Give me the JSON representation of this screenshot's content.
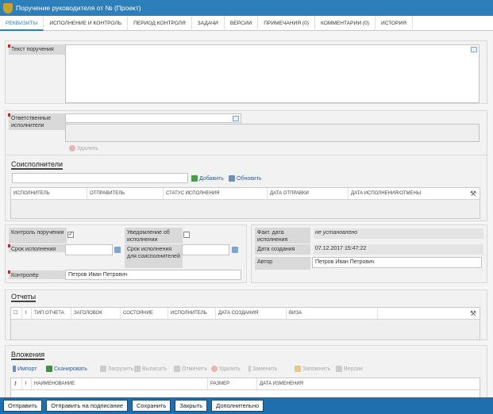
{
  "window": {
    "title": "Поручение руководителя от № (Проект)"
  },
  "tabs": [
    "РЕКВИЗИТЫ",
    "ИСПОЛНЕНИЕ И КОНТРОЛЬ",
    "ПЕРИОД КОНТРОЛЯ",
    "ЗАДАЧИ",
    "ВЕРСИИ",
    "ПРИМЕЧАНИЯ (0)",
    "КОММЕНТАРИИ (0)",
    "ИСТОРИЯ"
  ],
  "assignment": {
    "text_label": "Текст поручения"
  },
  "responsible": {
    "label": "Ответственные исполнители",
    "delete_label": "Удалить"
  },
  "coexecutors": {
    "title": "Соисполнители",
    "add_label": "Добавить",
    "refresh_label": "Обновить",
    "columns": [
      "ИСПОЛНИТЕЛЬ",
      "ОТПРАВИТЕЛЬ",
      "СТАТУС ИСПОЛНЕНИЯ",
      "ДАТА ОТПРАВКИ",
      "ДАТА ИСПОЛНЕНИЯ/ОТМЕНЫ"
    ]
  },
  "control": {
    "control_label": "Контроль поручения",
    "control_checked": true,
    "notify_label": "Уведомление об исполнении",
    "notify_checked": false,
    "due_label": "Срок исполнения",
    "co_due_label": "Срок исполнения для соисполнителей",
    "controller_label": "Контролёр",
    "controller_value": "Петров Иван Петрович"
  },
  "meta": {
    "fact_label": "Факт. дата исполнения",
    "fact_value": "не установлено",
    "created_label": "Дата создания",
    "created_value": "07.12.2017 15:47:22",
    "author_label": "Автор",
    "author_value": "Петров Иван Петрович"
  },
  "reports": {
    "title": "Отчеты",
    "columns": [
      "ТИП ОТЧЕТА",
      "ЗАГОЛОВОК",
      "СОСТОЯНИЕ",
      "ИСПОЛНИТЕЛЬ",
      "ДАТА СОЗДАНИЯ",
      "ВИЗА"
    ]
  },
  "attachments": {
    "title": "Вложения",
    "toolbar": [
      "Импорт",
      "Сканировать",
      "Загрузить",
      "Выписать",
      "Отменить",
      "Удалить",
      "Заменить",
      "Запомнить",
      "Версии"
    ],
    "columns": [
      "НАИМЕНОВАНИЕ",
      "РАЗМЕР",
      "ДАТА ИЗМЕНЕНИЯ"
    ]
  },
  "footer": [
    "Отправить",
    "Отправить на подписание",
    "Сохранить",
    "Закрыть",
    "Дополнительно"
  ]
}
